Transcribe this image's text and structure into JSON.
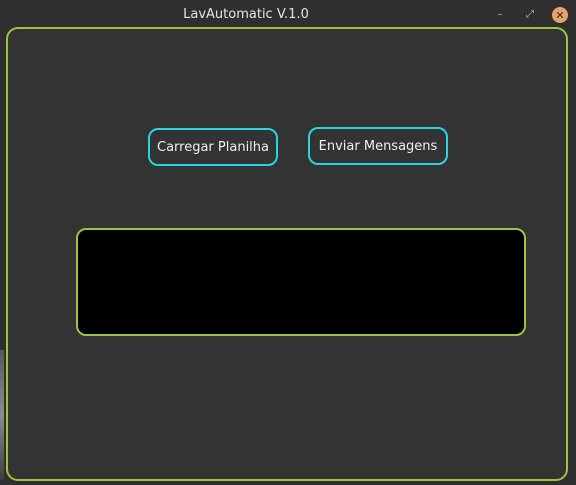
{
  "window": {
    "title": "LavAutomatic V.1.0",
    "controls": {
      "minimize_icon": "–",
      "maximize_icon": "⤢",
      "close_icon": "✕"
    }
  },
  "buttons": {
    "load_label": "Carregar Planilha",
    "send_label": "Enviar Mensagens"
  },
  "output": {
    "text": ""
  },
  "colors": {
    "frame_border": "#9bc53d",
    "button_border": "#27d6e0",
    "close_button": "#e8a26a",
    "background": "#333333",
    "output_bg": "#000000"
  }
}
